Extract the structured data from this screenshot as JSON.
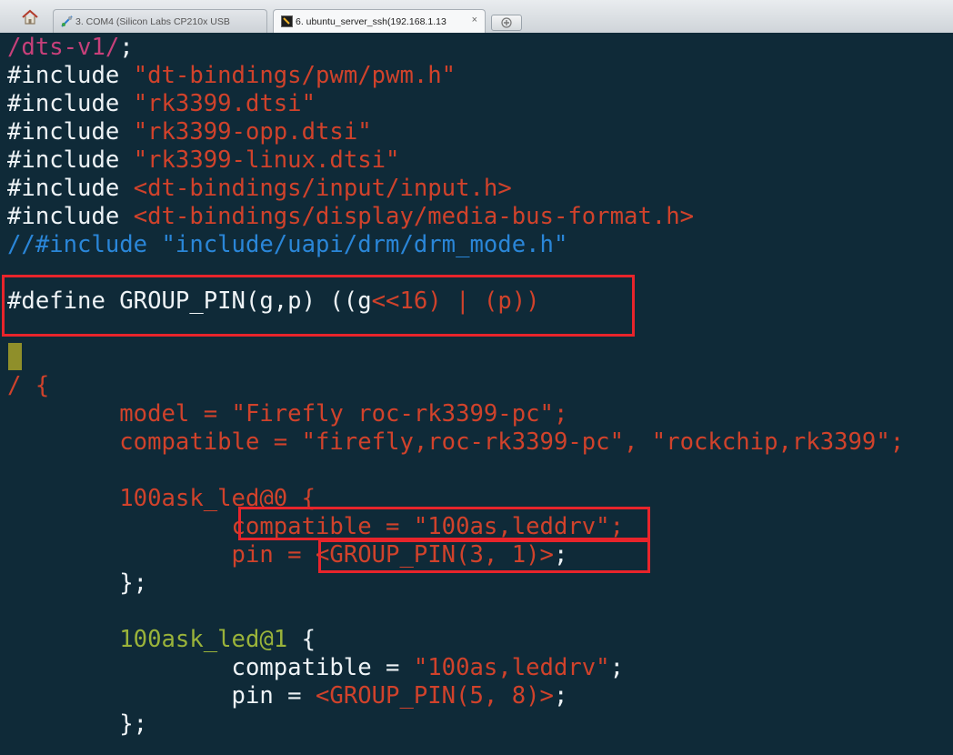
{
  "tabs": [
    {
      "label": "3. COM4  (Silicon Labs CP210x USB",
      "state": "inactive",
      "icon": "serial-connection-icon"
    },
    {
      "label": "6. ubuntu_server_ssh(192.168.1.13",
      "state": "active",
      "icon": "ssh-terminal-icon",
      "close": "×"
    }
  ],
  "colors": {
    "background": "#0f2a38",
    "string": "#d0422b",
    "keyword_green": "#9ab33a",
    "comment": "#2a86d8",
    "highlight_box": "#e8242b",
    "cursor": "#8f8f2a"
  },
  "code": {
    "l1": [
      "/dts-v1/",
      ";"
    ],
    "l2": [
      "#include ",
      "\"dt-bindings/pwm/pwm.h\""
    ],
    "l3": [
      "#include ",
      "\"rk3399.dtsi\""
    ],
    "l4": [
      "#include ",
      "\"rk3399-opp.dtsi\""
    ],
    "l5": [
      "#include ",
      "\"rk3399-linux.dtsi\""
    ],
    "l6": [
      "#include ",
      "<dt-bindings/input/input.h>"
    ],
    "l7": [
      "#include ",
      "<dt-bindings/display/media-bus-format.h>"
    ],
    "l8": [
      "//#include \"include/uapi/drm/drm_mode.h\""
    ],
    "l9": [
      "#define GROUP_PIN(g,p) ((g",
      "<<16) | (p))"
    ],
    "l10": [
      "/ {"
    ],
    "l11": [
      "        model = \"Firefly roc-rk3399-pc\";"
    ],
    "l12": [
      "        compatible = \"firefly,roc-rk3399-pc\", \"rockchip,rk3399\";"
    ],
    "l13": [
      "        100ask_led@0 {"
    ],
    "l14": [
      "                compatible = \"100as,leddrv\";"
    ],
    "l15": [
      "                pin = ",
      "<GROUP_PIN(3, 1)>",
      ";"
    ],
    "l16": [
      "        };"
    ],
    "l17": [
      "        100ask_led@1",
      " {"
    ],
    "l18": [
      "                compatible = ",
      "\"100as,leddrv\"",
      ";"
    ],
    "l19": [
      "                pin = ",
      "<GROUP_PIN(5, 8)>",
      ";"
    ],
    "l20": [
      "        };"
    ]
  }
}
